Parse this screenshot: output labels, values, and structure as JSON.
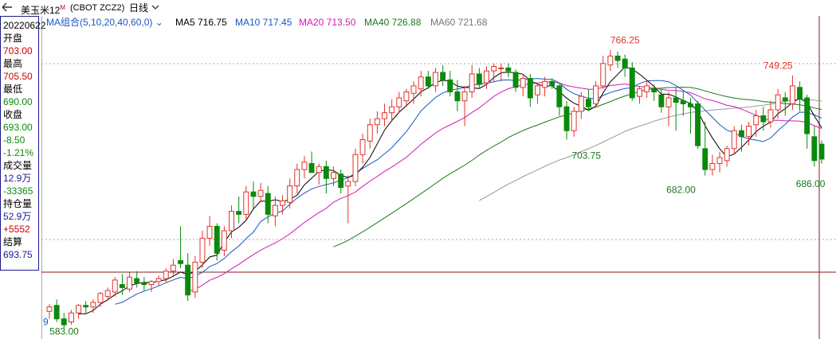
{
  "header": {
    "instrument": "美玉米12",
    "superscript": "M",
    "exchange": "(CBOT ZCZ2)",
    "period": "日线",
    "indicator": "MA组合(5,10,20,40,60,0)",
    "ma": [
      {
        "label": "MA5 716.75",
        "color": "#000000"
      },
      {
        "label": "MA10 717.45",
        "color": "#1a56c8"
      },
      {
        "label": "MA20 713.50",
        "color": "#d419b4"
      },
      {
        "label": "MA40 726.88",
        "color": "#1a7a1a"
      },
      {
        "label": "MA60 721.68",
        "color": "#777777"
      }
    ]
  },
  "sidebar": {
    "date": "20220622",
    "open_label": "开盘",
    "open": "703.00",
    "high_label": "最高",
    "high": "705.50",
    "low_label": "最低",
    "low": "690.00",
    "close_label": "收盘",
    "close": "693.00",
    "change": "-8.50",
    "change_pct": "-1.21%",
    "volume_label": "成交量",
    "volume": "12.9万",
    "volume_change": "-33365",
    "oi_label": "持仓量",
    "oi": "52.9万",
    "oi_change": "+5552",
    "settle_label": "结算",
    "settle": "693.75"
  },
  "chart_data": {
    "type": "candlestick",
    "ylim": [
      580,
      775
    ],
    "colors": {
      "up": "#e0342a",
      "down": "#0a8a0a",
      "ma5": "#000000",
      "ma10": "#1a56c8",
      "ma20": "#d419b4",
      "ma40": "#1a7a1a",
      "ma60": "#999999"
    },
    "candles": [
      [
        591,
        596,
        586,
        594
      ],
      [
        595,
        599,
        584,
        586
      ],
      [
        586,
        590,
        580,
        582
      ],
      [
        584,
        592,
        582,
        590
      ],
      [
        590,
        596,
        586,
        595
      ],
      [
        595,
        598,
        589,
        594
      ],
      [
        594,
        599,
        590,
        597
      ],
      [
        597,
        604,
        594,
        603
      ],
      [
        601,
        607,
        598,
        605
      ],
      [
        604,
        614,
        601,
        612
      ],
      [
        609,
        616,
        602,
        607
      ],
      [
        606,
        617,
        604,
        614
      ],
      [
        613,
        618,
        607,
        610
      ],
      [
        610,
        614,
        605,
        609
      ],
      [
        609,
        612,
        604,
        611
      ],
      [
        611,
        615,
        608,
        613
      ],
      [
        613,
        620,
        610,
        618
      ],
      [
        618,
        626,
        614,
        622
      ],
      [
        625,
        648,
        620,
        623
      ],
      [
        622,
        630,
        598,
        602
      ],
      [
        604,
        628,
        600,
        624
      ],
      [
        624,
        645,
        620,
        640
      ],
      [
        640,
        655,
        635,
        648
      ],
      [
        648,
        650,
        625,
        630
      ],
      [
        632,
        648,
        628,
        645
      ],
      [
        645,
        662,
        640,
        658
      ],
      [
        658,
        668,
        650,
        656
      ],
      [
        656,
        675,
        652,
        671
      ],
      [
        671,
        678,
        660,
        668
      ],
      [
        668,
        677,
        664,
        672
      ],
      [
        670,
        675,
        650,
        656
      ],
      [
        655,
        668,
        648,
        662
      ],
      [
        662,
        669,
        656,
        665
      ],
      [
        664,
        680,
        660,
        675
      ],
      [
        675,
        690,
        670,
        686
      ],
      [
        686,
        695,
        680,
        691
      ],
      [
        690,
        698,
        684,
        684
      ],
      [
        684,
        690,
        676,
        688
      ],
      [
        688,
        692,
        670,
        680
      ],
      [
        680,
        688,
        675,
        684
      ],
      [
        683,
        686,
        670,
        674
      ],
      [
        675,
        682,
        650,
        678
      ],
      [
        678,
        700,
        675,
        696
      ],
      [
        696,
        710,
        690,
        706
      ],
      [
        705,
        720,
        700,
        716
      ],
      [
        716,
        725,
        710,
        720
      ],
      [
        720,
        730,
        715,
        724
      ],
      [
        724,
        733,
        718,
        728
      ],
      [
        728,
        738,
        724,
        734
      ],
      [
        732,
        740,
        728,
        738
      ],
      [
        737,
        745,
        730,
        742
      ],
      [
        740,
        752,
        735,
        748
      ],
      [
        748,
        752,
        740,
        742
      ],
      [
        742,
        754,
        738,
        751
      ],
      [
        751,
        756,
        742,
        746
      ],
      [
        746,
        752,
        735,
        738
      ],
      [
        738,
        746,
        725,
        732
      ],
      [
        732,
        742,
        715,
        738
      ],
      [
        738,
        756,
        734,
        750
      ],
      [
        750,
        754,
        740,
        743
      ],
      [
        744,
        755,
        740,
        752
      ],
      [
        752,
        757,
        745,
        755
      ],
      [
        754,
        757,
        745,
        754
      ],
      [
        754,
        757,
        748,
        752
      ],
      [
        751,
        753,
        738,
        741
      ],
      [
        741,
        749,
        735,
        747
      ],
      [
        747,
        750,
        728,
        734
      ],
      [
        736,
        744,
        730,
        742
      ],
      [
        741,
        748,
        735,
        745
      ],
      [
        745,
        747,
        740,
        742
      ],
      [
        742,
        744,
        722,
        728
      ],
      [
        728,
        732,
        706,
        712
      ],
      [
        712,
        728,
        708,
        725
      ],
      [
        725,
        738,
        720,
        735
      ],
      [
        733,
        740,
        725,
        728
      ],
      [
        730,
        745,
        728,
        742
      ],
      [
        742,
        762,
        740,
        757
      ],
      [
        756,
        766,
        752,
        762
      ],
      [
        762,
        765,
        754,
        759
      ],
      [
        760,
        763,
        748,
        754
      ],
      [
        754,
        758,
        732,
        734
      ],
      [
        735,
        742,
        730,
        740
      ],
      [
        738,
        746,
        734,
        742
      ],
      [
        740,
        743,
        732,
        738
      ],
      [
        736,
        740,
        724,
        728
      ],
      [
        728,
        738,
        715,
        734
      ],
      [
        734,
        741,
        712,
        731
      ],
      [
        732,
        738,
        722,
        730
      ],
      [
        730,
        734,
        710,
        728
      ],
      [
        730,
        732,
        700,
        702
      ],
      [
        700,
        718,
        682,
        686
      ],
      [
        686,
        696,
        682,
        690
      ],
      [
        690,
        698,
        684,
        694
      ],
      [
        692,
        702,
        688,
        700
      ],
      [
        700,
        715,
        696,
        712
      ],
      [
        712,
        716,
        698,
        708
      ],
      [
        708,
        718,
        702,
        715
      ],
      [
        716,
        726,
        708,
        722
      ],
      [
        722,
        728,
        712,
        718
      ],
      [
        718,
        732,
        714,
        726
      ],
      [
        726,
        740,
        720,
        736
      ],
      [
        734,
        738,
        722,
        732
      ],
      [
        730,
        749,
        726,
        742
      ],
      [
        741,
        745,
        725,
        733
      ],
      [
        734,
        736,
        700,
        710
      ],
      [
        708,
        715,
        688,
        692
      ],
      [
        703,
        705.5,
        690,
        693
      ]
    ],
    "annotations": [
      {
        "label": "766.25",
        "color": "#e0342a"
      },
      {
        "label": "703.75",
        "color": "#1a7a1a"
      },
      {
        "label": "749.25",
        "color": "#e0342a"
      },
      {
        "label": "682.00",
        "color": "#1a7a1a"
      },
      {
        "label": "686.00",
        "color": "#1a7a1a"
      },
      {
        "label": "583.00",
        "color": "#1a7a1a"
      },
      {
        "label": "9",
        "color": "#1a56c8"
      }
    ]
  }
}
